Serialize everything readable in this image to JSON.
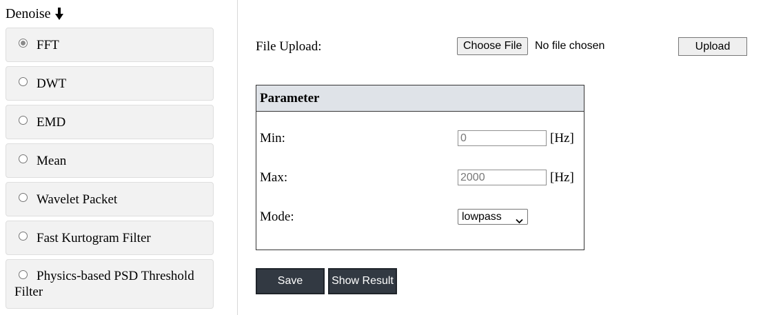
{
  "sidebar": {
    "title": "Denoise",
    "title_icon": "down-arrow-icon",
    "methods": [
      {
        "label": "FFT",
        "selected": true
      },
      {
        "label": "DWT",
        "selected": false
      },
      {
        "label": "EMD",
        "selected": false
      },
      {
        "label": "Mean",
        "selected": false
      },
      {
        "label": "Wavelet Packet",
        "selected": false
      },
      {
        "label": "Fast Kurtogram Filter",
        "selected": false
      },
      {
        "label": "Physics-based PSD Threshold Filter",
        "selected": false
      }
    ]
  },
  "upload": {
    "label": "File Upload:",
    "choose_label": "Choose File",
    "status": "No file chosen",
    "upload_label": "Upload"
  },
  "parameter": {
    "header": "Parameter",
    "min_label": "Min:",
    "min_value": "0",
    "min_unit": "[Hz]",
    "max_label": "Max:",
    "max_value": "2000",
    "max_unit": "[Hz]",
    "mode_label": "Mode:",
    "mode_value": "lowpass"
  },
  "actions": {
    "save_label": "Save",
    "show_result_label": "Show Result"
  },
  "colors": {
    "button_dark": "#323942",
    "header_bg": "#dfe3e8",
    "item_bg": "#f2f2f2"
  }
}
